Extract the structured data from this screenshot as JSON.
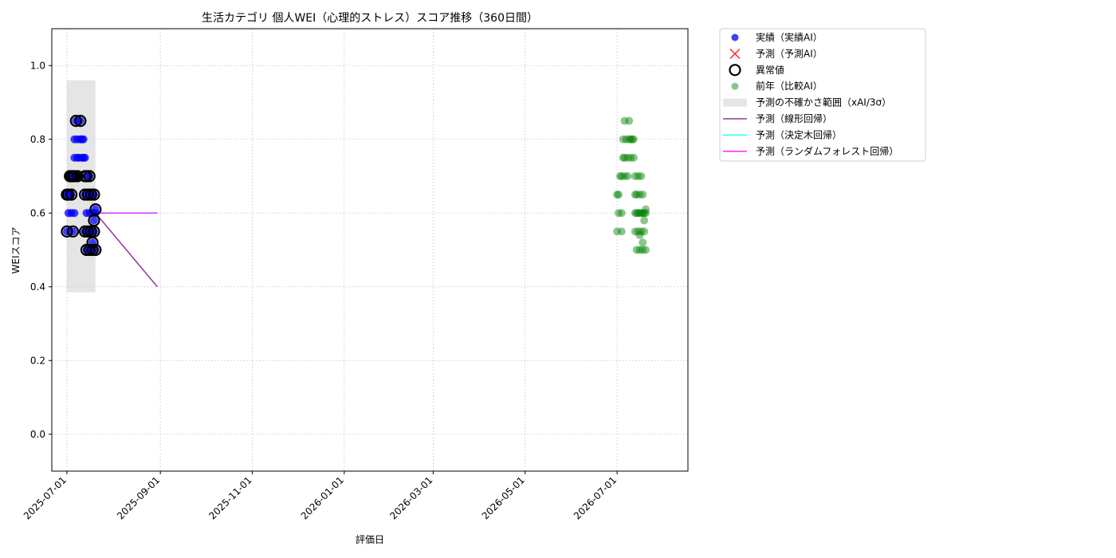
{
  "chart_data": {
    "type": "scatter",
    "title": "生活カテゴリ 個人WEI（心理的ストレス）スコア推移（360日間）",
    "xlabel": "評価日",
    "ylabel": "WEIスコア",
    "xlim": [
      "2025-06-21",
      "2026-08-17"
    ],
    "ylim": [
      -0.1,
      1.1
    ],
    "x_ticks": [
      "2025-07-01",
      "2025-09-01",
      "2025-11-01",
      "2026-01-01",
      "2026-03-01",
      "2026-05-01",
      "2026-07-01"
    ],
    "y_ticks": [
      0.0,
      0.2,
      0.4,
      0.6,
      0.8,
      1.0
    ],
    "y_tick_labels": [
      "0.0",
      "0.2",
      "0.4",
      "0.6",
      "0.8",
      "1.0"
    ],
    "grid": true,
    "legend_position": "outside-upper-right",
    "series": [
      {
        "name": "実績（実績AI）",
        "kind": "scatter",
        "color": "#0000ff",
        "points": [
          {
            "x": "2025-07-01",
            "y": 0.65
          },
          {
            "x": "2025-07-01",
            "y": 0.55
          },
          {
            "x": "2025-07-02",
            "y": 0.6
          },
          {
            "x": "2025-07-02",
            "y": 0.65
          },
          {
            "x": "2025-07-03",
            "y": 0.7
          },
          {
            "x": "2025-07-04",
            "y": 0.65
          },
          {
            "x": "2025-07-04",
            "y": 0.6
          },
          {
            "x": "2025-07-04",
            "y": 0.7
          },
          {
            "x": "2025-07-05",
            "y": 0.55
          },
          {
            "x": "2025-07-05",
            "y": 0.7
          },
          {
            "x": "2025-07-06",
            "y": 0.6
          },
          {
            "x": "2025-07-06",
            "y": 0.75
          },
          {
            "x": "2025-07-06",
            "y": 0.8
          },
          {
            "x": "2025-07-07",
            "y": 0.85
          },
          {
            "x": "2025-07-07",
            "y": 0.7
          },
          {
            "x": "2025-07-08",
            "y": 0.75
          },
          {
            "x": "2025-07-08",
            "y": 0.8
          },
          {
            "x": "2025-07-09",
            "y": 0.7
          },
          {
            "x": "2025-07-09",
            "y": 0.75
          },
          {
            "x": "2025-07-10",
            "y": 0.8
          },
          {
            "x": "2025-07-10",
            "y": 0.85
          },
          {
            "x": "2025-07-11",
            "y": 0.75
          },
          {
            "x": "2025-07-11",
            "y": 0.8
          },
          {
            "x": "2025-07-12",
            "y": 0.75
          },
          {
            "x": "2025-07-12",
            "y": 0.8
          },
          {
            "x": "2025-07-13",
            "y": 0.75
          },
          {
            "x": "2025-07-13",
            "y": 0.65
          },
          {
            "x": "2025-07-13",
            "y": 0.55
          },
          {
            "x": "2025-07-14",
            "y": 0.7
          },
          {
            "x": "2025-07-14",
            "y": 0.6
          },
          {
            "x": "2025-07-14",
            "y": 0.5
          },
          {
            "x": "2025-07-15",
            "y": 0.65
          },
          {
            "x": "2025-07-15",
            "y": 0.55
          },
          {
            "x": "2025-07-16",
            "y": 0.6
          },
          {
            "x": "2025-07-16",
            "y": 0.5
          },
          {
            "x": "2025-07-16",
            "y": 0.7
          },
          {
            "x": "2025-07-17",
            "y": 0.65
          },
          {
            "x": "2025-07-17",
            "y": 0.55
          },
          {
            "x": "2025-07-18",
            "y": 0.6
          },
          {
            "x": "2025-07-18",
            "y": 0.5
          },
          {
            "x": "2025-07-18",
            "y": 0.52
          },
          {
            "x": "2025-07-19",
            "y": 0.65
          },
          {
            "x": "2025-07-19",
            "y": 0.55
          },
          {
            "x": "2025-07-19",
            "y": 0.58
          },
          {
            "x": "2025-07-20",
            "y": 0.61
          },
          {
            "x": "2025-07-20",
            "y": 0.5
          },
          {
            "x": "2025-07-20",
            "y": 0.6
          }
        ]
      },
      {
        "name": "予測（予測AI）",
        "kind": "scatter-x",
        "color": "#ff0000",
        "points": []
      },
      {
        "name": "異常値",
        "kind": "ring",
        "color": "#000000",
        "points": [
          {
            "x": "2025-07-01",
            "y": 0.65
          },
          {
            "x": "2025-07-01",
            "y": 0.55
          },
          {
            "x": "2025-07-02",
            "y": 0.65
          },
          {
            "x": "2025-07-03",
            "y": 0.7
          },
          {
            "x": "2025-07-04",
            "y": 0.7
          },
          {
            "x": "2025-07-04",
            "y": 0.65
          },
          {
            "x": "2025-07-05",
            "y": 0.55
          },
          {
            "x": "2025-07-05",
            "y": 0.7
          },
          {
            "x": "2025-07-06",
            "y": 0.7
          },
          {
            "x": "2025-07-07",
            "y": 0.85
          },
          {
            "x": "2025-07-08",
            "y": 0.7
          },
          {
            "x": "2025-07-10",
            "y": 0.85
          },
          {
            "x": "2025-07-13",
            "y": 0.7
          },
          {
            "x": "2025-07-13",
            "y": 0.65
          },
          {
            "x": "2025-07-13",
            "y": 0.55
          },
          {
            "x": "2025-07-14",
            "y": 0.5
          },
          {
            "x": "2025-07-14",
            "y": 0.7
          },
          {
            "x": "2025-07-15",
            "y": 0.65
          },
          {
            "x": "2025-07-15",
            "y": 0.55
          },
          {
            "x": "2025-07-16",
            "y": 0.5
          },
          {
            "x": "2025-07-16",
            "y": 0.7
          },
          {
            "x": "2025-07-17",
            "y": 0.65
          },
          {
            "x": "2025-07-17",
            "y": 0.55
          },
          {
            "x": "2025-07-18",
            "y": 0.5
          },
          {
            "x": "2025-07-18",
            "y": 0.52
          },
          {
            "x": "2025-07-19",
            "y": 0.65
          },
          {
            "x": "2025-07-19",
            "y": 0.55
          },
          {
            "x": "2025-07-19",
            "y": 0.58
          },
          {
            "x": "2025-07-20",
            "y": 0.61
          },
          {
            "x": "2025-07-20",
            "y": 0.5
          }
        ]
      },
      {
        "name": "前年（比較AI）",
        "kind": "scatter",
        "color": "#008000",
        "points": [
          {
            "x": "2026-07-01",
            "y": 0.65
          },
          {
            "x": "2026-07-01",
            "y": 0.55
          },
          {
            "x": "2026-07-02",
            "y": 0.6
          },
          {
            "x": "2026-07-02",
            "y": 0.65
          },
          {
            "x": "2026-07-03",
            "y": 0.7
          },
          {
            "x": "2026-07-04",
            "y": 0.6
          },
          {
            "x": "2026-07-04",
            "y": 0.55
          },
          {
            "x": "2026-07-04",
            "y": 0.7
          },
          {
            "x": "2026-07-05",
            "y": 0.75
          },
          {
            "x": "2026-07-05",
            "y": 0.8
          },
          {
            "x": "2026-07-06",
            "y": 0.7
          },
          {
            "x": "2026-07-06",
            "y": 0.85
          },
          {
            "x": "2026-07-06",
            "y": 0.75
          },
          {
            "x": "2026-07-07",
            "y": 0.8
          },
          {
            "x": "2026-07-08",
            "y": 0.75
          },
          {
            "x": "2026-07-08",
            "y": 0.7
          },
          {
            "x": "2026-07-09",
            "y": 0.8
          },
          {
            "x": "2026-07-09",
            "y": 0.85
          },
          {
            "x": "2026-07-10",
            "y": 0.75
          },
          {
            "x": "2026-07-10",
            "y": 0.8
          },
          {
            "x": "2026-07-11",
            "y": 0.8
          },
          {
            "x": "2026-07-12",
            "y": 0.75
          },
          {
            "x": "2026-07-12",
            "y": 0.8
          },
          {
            "x": "2026-07-13",
            "y": 0.7
          },
          {
            "x": "2026-07-13",
            "y": 0.65
          },
          {
            "x": "2026-07-13",
            "y": 0.6
          },
          {
            "x": "2026-07-13",
            "y": 0.55
          },
          {
            "x": "2026-07-14",
            "y": 0.65
          },
          {
            "x": "2026-07-14",
            "y": 0.6
          },
          {
            "x": "2026-07-14",
            "y": 0.5
          },
          {
            "x": "2026-07-15",
            "y": 0.7
          },
          {
            "x": "2026-07-15",
            "y": 0.55
          },
          {
            "x": "2026-07-15",
            "y": 0.6
          },
          {
            "x": "2026-07-16",
            "y": 0.65
          },
          {
            "x": "2026-07-16",
            "y": 0.6
          },
          {
            "x": "2026-07-16",
            "y": 0.5
          },
          {
            "x": "2026-07-16",
            "y": 0.54
          },
          {
            "x": "2026-07-17",
            "y": 0.7
          },
          {
            "x": "2026-07-17",
            "y": 0.6
          },
          {
            "x": "2026-07-17",
            "y": 0.55
          },
          {
            "x": "2026-07-18",
            "y": 0.65
          },
          {
            "x": "2026-07-18",
            "y": 0.52
          },
          {
            "x": "2026-07-18",
            "y": 0.5
          },
          {
            "x": "2026-07-18",
            "y": 0.6
          },
          {
            "x": "2026-07-19",
            "y": 0.6
          },
          {
            "x": "2026-07-19",
            "y": 0.58
          },
          {
            "x": "2026-07-19",
            "y": 0.55
          },
          {
            "x": "2026-07-20",
            "y": 0.6
          },
          {
            "x": "2026-07-20",
            "y": 0.61
          },
          {
            "x": "2026-07-20",
            "y": 0.5
          }
        ]
      },
      {
        "name": "予測の不確かさ範囲（xAI/3σ）",
        "kind": "band",
        "color": "#d3d3d3",
        "x": [
          "2025-07-01",
          "2025-07-20"
        ],
        "y_lower": 0.385,
        "y_upper": 0.96
      },
      {
        "name": "予測（線形回帰）",
        "kind": "line",
        "color": "#800080",
        "points": [
          {
            "x": "2025-07-20",
            "y": 0.6
          },
          {
            "x": "2025-08-30",
            "y": 0.4
          }
        ]
      },
      {
        "name": "予測（決定木回帰）",
        "kind": "line",
        "color": "#00ffff",
        "points": [
          {
            "x": "2025-07-20",
            "y": 0.6
          },
          {
            "x": "2025-08-30",
            "y": 0.6
          }
        ]
      },
      {
        "name": "予測（ランダムフォレスト回帰）",
        "kind": "line",
        "color": "#ff00ff",
        "points": [
          {
            "x": "2025-07-20",
            "y": 0.6
          },
          {
            "x": "2025-08-30",
            "y": 0.6
          }
        ]
      }
    ]
  }
}
